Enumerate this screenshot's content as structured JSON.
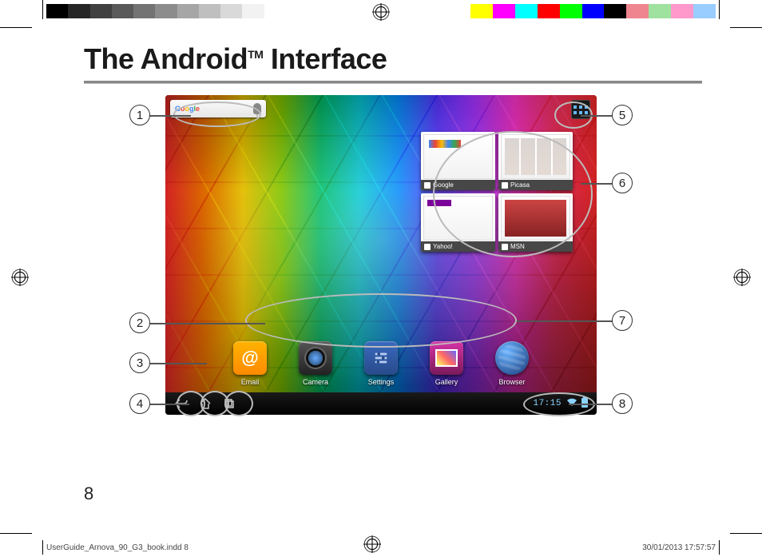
{
  "document": {
    "title_pre": "The Android",
    "title_sup": "TM",
    "title_post": " Interface",
    "page_number": "8",
    "slug_file": "UserGuide_Arnova_90_G3_book.indd   8",
    "slug_date": "30/01/2013   17:57:57"
  },
  "print_bars": {
    "left": [
      "#000000",
      "#262626",
      "#404040",
      "#595959",
      "#737373",
      "#8c8c8c",
      "#a6a6a6",
      "#bfbfbf",
      "#d9d9d9",
      "#f2f2f2",
      "#ffffff"
    ],
    "right": [
      "#ffffff",
      "#ffff00",
      "#ff00ff",
      "#00ffff",
      "#ff0000",
      "#00ff00",
      "#0000ff",
      "#000000",
      "#ee858f",
      "#9fe29f",
      "#ff99cc",
      "#99ccff"
    ]
  },
  "tablet": {
    "search_label": "Google",
    "widgets": {
      "bookmarks": [
        {
          "label": "Google"
        },
        {
          "label": "Picasa"
        },
        {
          "label": "Yahoo!"
        },
        {
          "label": "MSN"
        }
      ]
    },
    "apps": [
      {
        "name": "Email"
      },
      {
        "name": "Camera"
      },
      {
        "name": "Settings"
      },
      {
        "name": "Gallery"
      },
      {
        "name": "Browser"
      }
    ],
    "status": {
      "time": "17:15"
    }
  },
  "callouts": [
    "1",
    "2",
    "3",
    "4",
    "5",
    "6",
    "7",
    "8"
  ]
}
